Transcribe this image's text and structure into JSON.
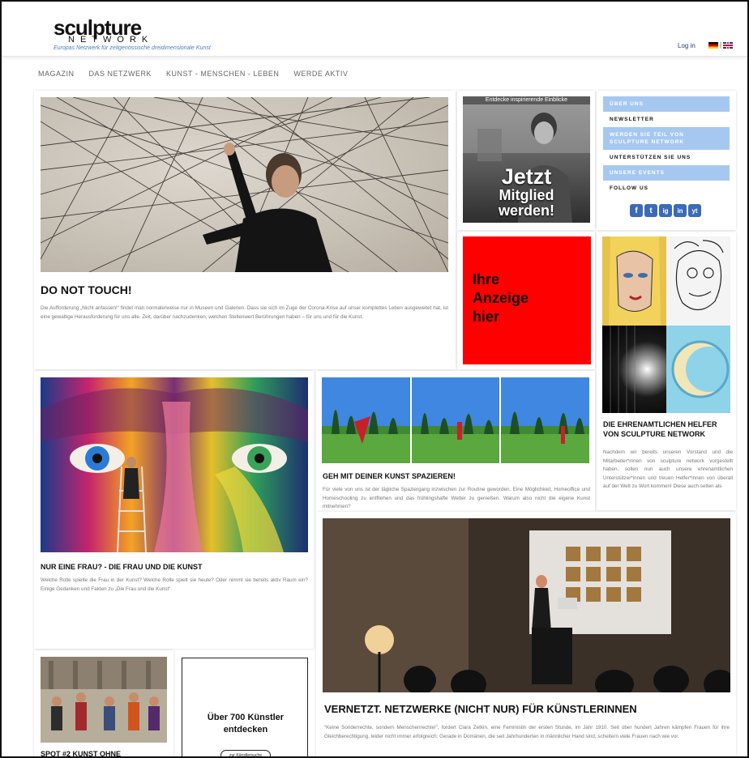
{
  "header": {
    "logo_main": "sculpture",
    "logo_sub": "NETWORK",
    "logo_tagline": "Europas Netzwerk für zeitgenössische dreidimensionale Kunst",
    "login_label": "Log in",
    "flag_separator": "|"
  },
  "nav": {
    "items": [
      "MAGAZIN",
      "DAS NETZWERK",
      "KUNST - MENSCHEN - LEBEN",
      "WERDE AKTIV"
    ]
  },
  "feature": {
    "title": "DO NOT TOUCH!",
    "text": "Die Aufforderung „Nicht anfassen!“ findet man normalerweise nur in Museen und Galerien. Dass sie sich im Zuge der Corona-Krise auf unser komplettes Leben ausgeweitet hat, ist eine gewaltige Herausforderung für uns alle. Zeit, darüber nachzudenken, welchen Stellenwert Berührungen haben – für uns und für die Kunst."
  },
  "member_promo": {
    "caption": "Entdecke inspirierende Einblicke",
    "line1": "Jetzt",
    "line2": "Mitglied",
    "line3": "werden!"
  },
  "sidebar": {
    "items": [
      "ÜBER UNS",
      "NEWSLETTER",
      "WERDEN SIE TEIL VON SCULPTURE NETWORK",
      "UNTERSTÜTZEN SIE UNS",
      "UNSERE EVENTS"
    ],
    "follow_label": "FOLLOW US",
    "social": [
      "f",
      "t",
      "ig",
      "in",
      "yt"
    ]
  },
  "ad": {
    "text_line1": "Ihre",
    "text_line2": "Anzeige",
    "text_line3": "hier",
    "color": "#ff0000"
  },
  "helpers": {
    "title": "DIE EHRENAMTLICHEN HELFER VON SCULPTURE NETWORK",
    "text": "Nachdem wir bereits unseren Vorstand und die Mitarbeiter*innen von sculpture network vorgestellt haben, sollen nun auch unsere ehrenamtlichen Unterstützer*innen und treuen Helfer*innen von überall auf der Welt zu Wort kommen! Diese auch selten als"
  },
  "woman": {
    "title": "NUR EINE FRAU? - DIE FRAU UND DIE KUNST",
    "text": "Welche Rolle spielte die Frau in der Kunst? Welche Rolle spielt sie heute? Oder nimmt sie bereits aktiv Raum ein? Einige Gedanken und Fakten zu „Die Frau und die Kunst“."
  },
  "walk": {
    "title": "GEH MIT DEINER KUNST SPAZIEREN!",
    "text": "Für viele von uns ist der tägliche Spaziergang inzwischen zur Routine geworden. Eine Möglichkeit, Homeoffice und Homeschooling zu entfliehen und das frühlingshafte Wetter zu genießen. Warum also nicht die eigene Kunst mitnehmen?"
  },
  "network": {
    "title": "VERNETZT. NETZWERKE (NICHT NUR) FÜR KÜNSTLERINNEN",
    "text": "“Keine Sonderrechte, sondern Menschenrechte!”, fordert Clara Zetkin, eine Feministin der ersten Stunde, im Jahr 1910. Seit über hundert Jahren kämpfen Frauen für ihre Gleichberechtigung, leider nicht immer erfolgreich; Gerade in Domänen, die seit Jahrhunderten in männlicher Hand sind, scheitern viele Frauen nach wie vor."
  },
  "spot": {
    "title": "SPOT #2 KUNST OHNE"
  },
  "artists": {
    "title": "Über 700 Künstler entdecken",
    "button_label": "zur Künstlersuche"
  }
}
